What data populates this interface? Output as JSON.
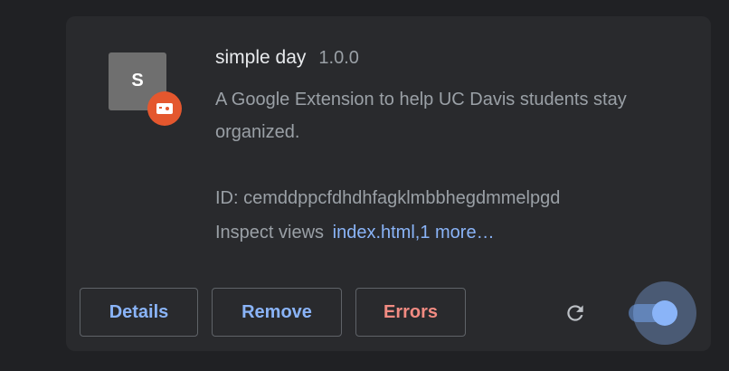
{
  "extension": {
    "icon_letter": "S",
    "name": "simple day",
    "version": "1.0.0",
    "description": "A Google Extension to help UC Davis students stay organized.",
    "id_text": "ID: cemddppcfdhdhfagklmbbhegdmmelpgd",
    "inspect_label": "Inspect views",
    "inspect_link": "index.html,1 more…"
  },
  "buttons": {
    "details": "Details",
    "remove": "Remove",
    "errors": "Errors"
  },
  "icons": {
    "reload": "reload-icon",
    "badge": "unpacked-extension-icon"
  },
  "toggle": {
    "enabled": true
  },
  "colors": {
    "background": "#202124",
    "card": "#292a2d",
    "accent": "#8ab4f8",
    "error": "#f28b82",
    "badge": "#e4572e"
  }
}
